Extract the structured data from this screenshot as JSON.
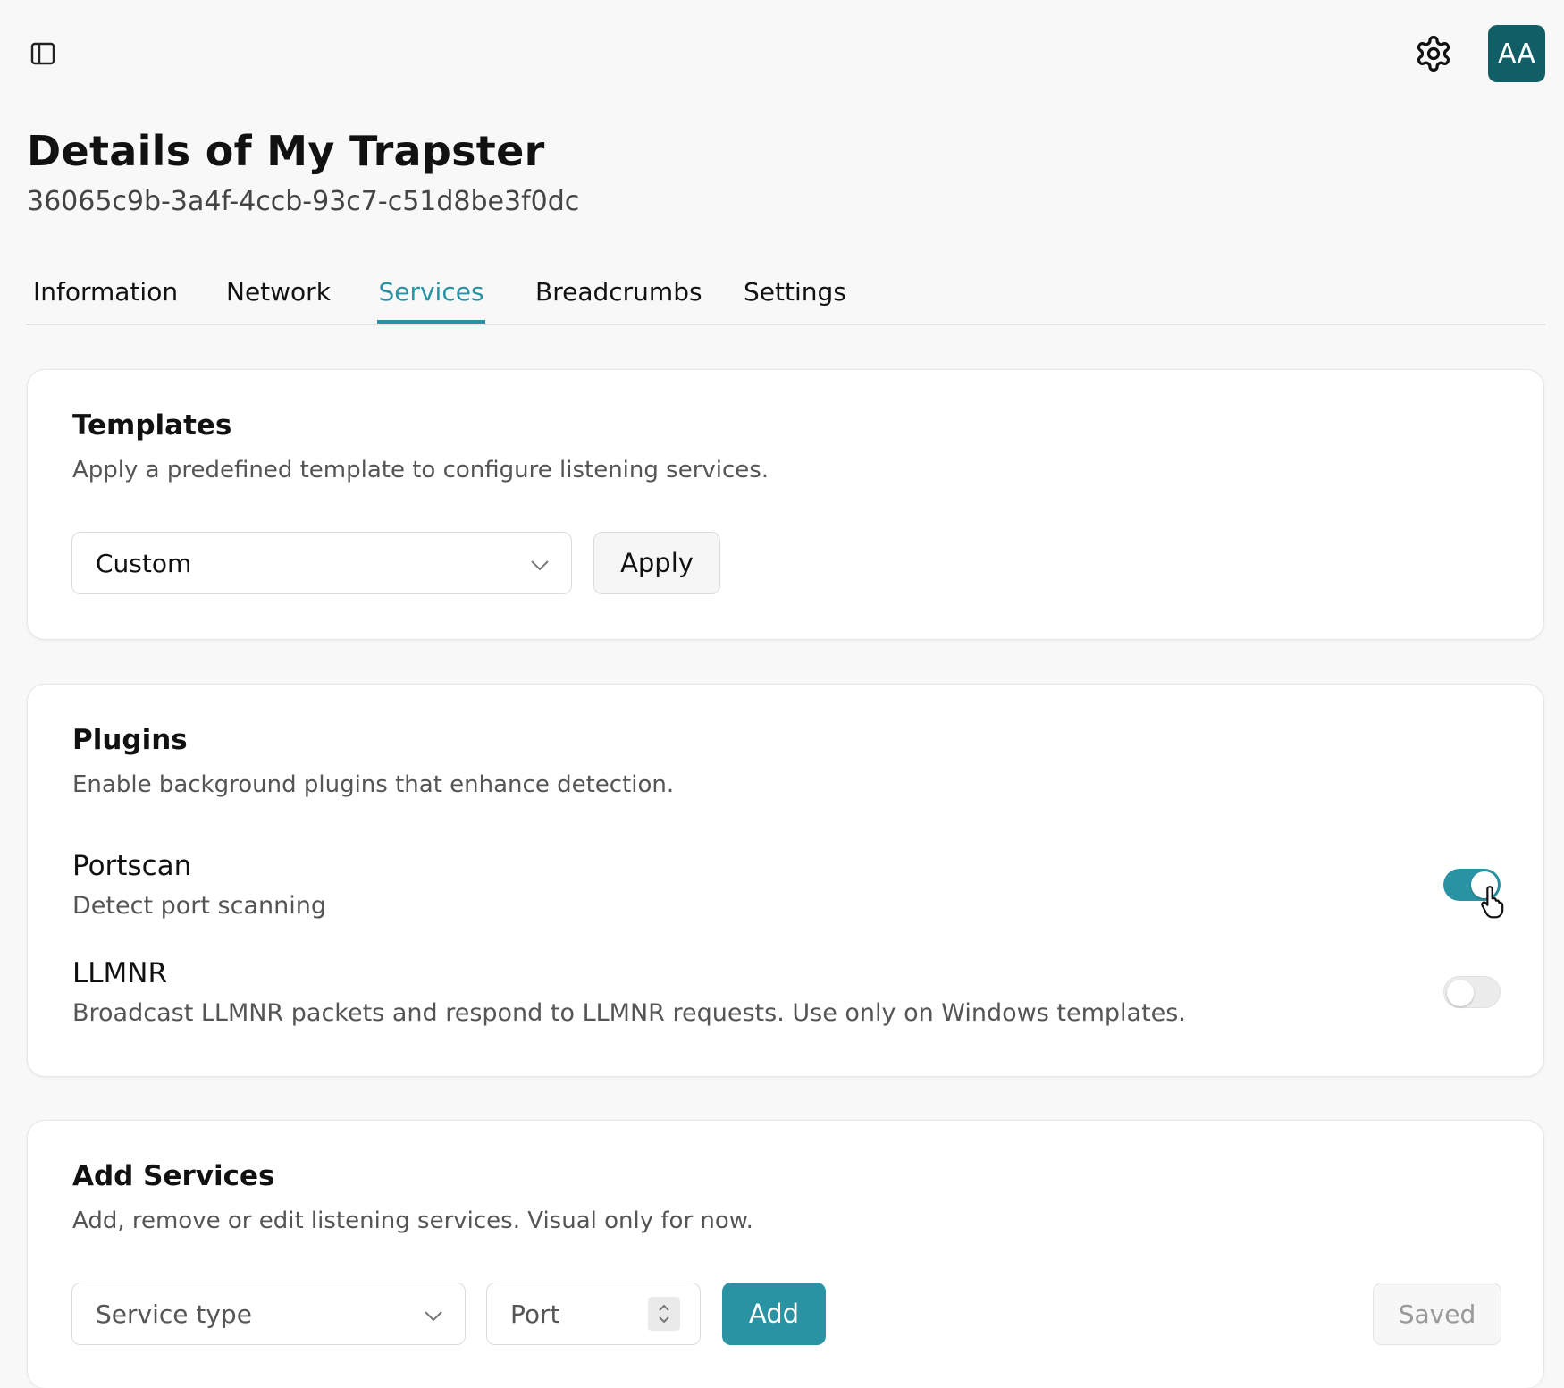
{
  "header": {
    "sidebar_toggle_icon": "sidebar-panel-icon",
    "settings_icon": "gear-icon",
    "avatar_initials": "AA",
    "avatar_color": "#115e67"
  },
  "page": {
    "title": "Details of My Trapster",
    "id": "36065c9b-3a4f-4ccb-93c7-c51d8be3f0dc"
  },
  "tabs": [
    {
      "label": "Information",
      "active": false
    },
    {
      "label": "Network",
      "active": false
    },
    {
      "label": "Services",
      "active": true
    },
    {
      "label": "Breadcrumbs",
      "active": false
    },
    {
      "label": "Settings",
      "active": false
    }
  ],
  "accent_color": "#2a93a3",
  "templates": {
    "title": "Templates",
    "description": "Apply a predefined template to configure listening services.",
    "selected": "Custom",
    "apply_label": "Apply"
  },
  "plugins": {
    "title": "Plugins",
    "description": "Enable background plugins that enhance detection.",
    "items": [
      {
        "name": "Portscan",
        "description": "Detect port scanning",
        "enabled": true
      },
      {
        "name": "LLMNR",
        "description": "Broadcast LLMNR packets and respond to LLMNR requests. Use only on Windows templates.",
        "enabled": false
      }
    ]
  },
  "add_services": {
    "title": "Add Services",
    "description": "Add, remove or edit listening services. Visual only for now.",
    "service_type_placeholder": "Service type",
    "port_placeholder": "Port",
    "add_label": "Add",
    "saved_label": "Saved"
  }
}
